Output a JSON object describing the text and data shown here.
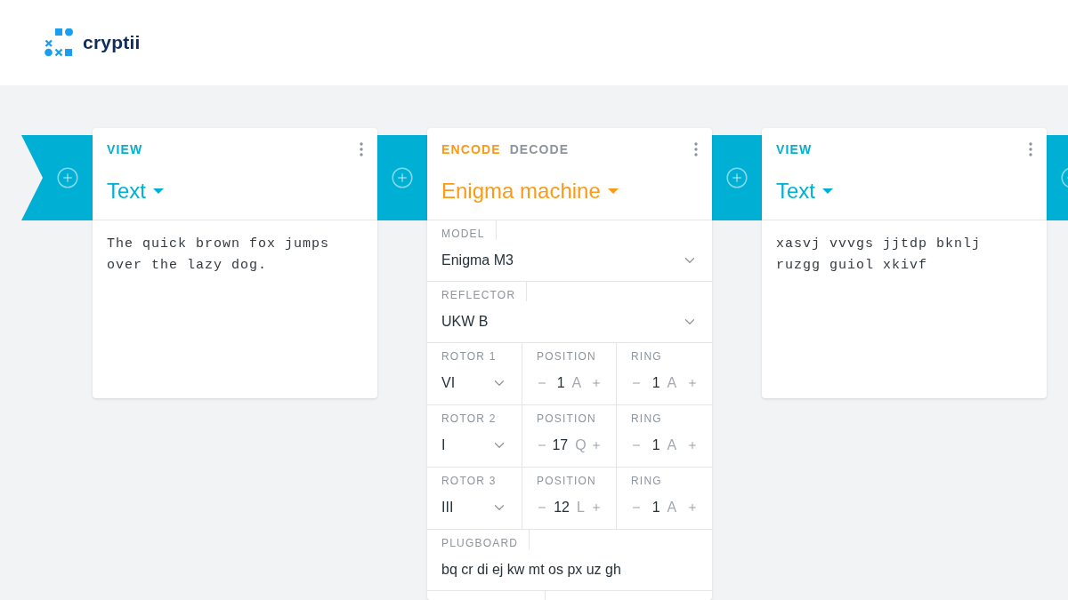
{
  "header": {
    "logo_text": "cryptii"
  },
  "pipeline": [
    {
      "kind": "view",
      "tabs": [
        {
          "label": "VIEW",
          "selected": true
        }
      ],
      "title": "Text",
      "content": "The quick brown fox jumps over the lazy dog."
    },
    {
      "kind": "encoder",
      "tabs": [
        {
          "label": "ENCODE",
          "selected": true
        },
        {
          "label": "DECODE",
          "selected": false
        }
      ],
      "title": "Enigma machine",
      "settings": [
        {
          "kind": "select",
          "label": "MODEL",
          "value": "Enigma M3"
        },
        {
          "kind": "select",
          "label": "REFLECTOR",
          "value": "UKW B"
        },
        {
          "kind": "row",
          "cells": [
            {
              "kind": "select",
              "label": "ROTOR 1",
              "value": "VI"
            },
            {
              "kind": "stepper",
              "label": "POSITION",
              "value": "1",
              "letter": "A"
            },
            {
              "kind": "stepper",
              "label": "RING",
              "value": "1",
              "letter": "A"
            }
          ]
        },
        {
          "kind": "row",
          "cells": [
            {
              "kind": "select",
              "label": "ROTOR 2",
              "value": "I"
            },
            {
              "kind": "stepper",
              "label": "POSITION",
              "value": "17",
              "letter": "Q"
            },
            {
              "kind": "stepper",
              "label": "RING",
              "value": "1",
              "letter": "A"
            }
          ]
        },
        {
          "kind": "row",
          "cells": [
            {
              "kind": "select",
              "label": "ROTOR 3",
              "value": "III"
            },
            {
              "kind": "stepper",
              "label": "POSITION",
              "value": "12",
              "letter": "L"
            },
            {
              "kind": "stepper",
              "label": "RING",
              "value": "1",
              "letter": "A"
            }
          ]
        },
        {
          "kind": "text",
          "label": "PLUGBOARD",
          "value": "bq cr di ej kw mt os px uz gh"
        }
      ]
    },
    {
      "kind": "view",
      "tabs": [
        {
          "label": "VIEW",
          "selected": true
        }
      ],
      "title": "Text",
      "content": "xasvj vvvgs jjtdp bknlj ruzgg guiol xkivf"
    }
  ]
}
